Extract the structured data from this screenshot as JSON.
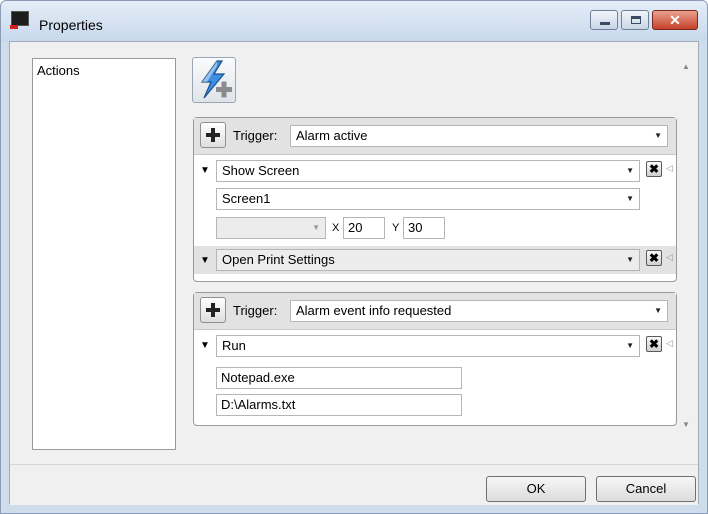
{
  "window": {
    "title": "Properties"
  },
  "title_buttons": {
    "close": "✕"
  },
  "left_panel": {
    "items": [
      {
        "label": "Actions"
      }
    ]
  },
  "groups": [
    {
      "trigger_label": "Trigger:",
      "trigger_value": "Alarm active",
      "actions": [
        {
          "name": "Show Screen",
          "params": {
            "screen": "Screen1",
            "x_label": "X",
            "x_value": "20",
            "y_label": "Y",
            "y_value": "30"
          }
        },
        {
          "name": "Open Print Settings"
        }
      ]
    },
    {
      "trigger_label": "Trigger:",
      "trigger_value": "Alarm event info requested",
      "actions": [
        {
          "name": "Run",
          "params": {
            "program": "Notepad.exe",
            "argument": "D:\\Alarms.txt"
          }
        }
      ]
    }
  ],
  "footer": {
    "ok_label": "OK",
    "cancel_label": "Cancel"
  },
  "colors": {
    "title_bar": "#c8d8ec",
    "close_button": "#c6402a",
    "trigger_band": "#e2e2e2"
  }
}
